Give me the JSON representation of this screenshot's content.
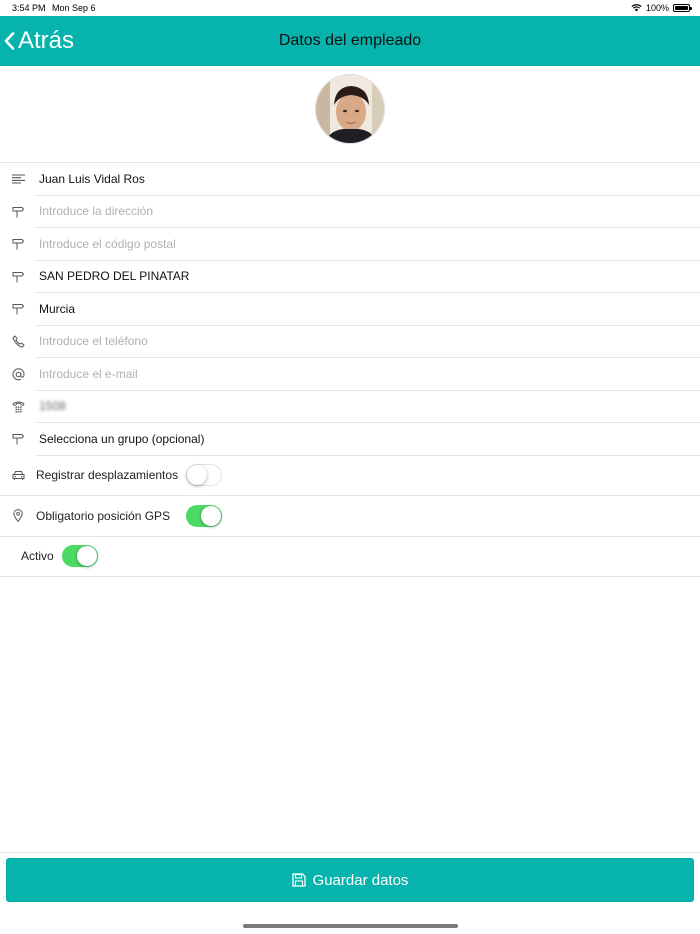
{
  "status_bar": {
    "time": "3:54 PM",
    "date": "Mon Sep 6",
    "battery": "100%"
  },
  "nav": {
    "back_label": "Atrás",
    "title": "Datos del empleado"
  },
  "form": {
    "name": "Juan Luis Vidal Ros",
    "address_placeholder": "Introduce la dirección",
    "postal_placeholder": "Introduce el código postal",
    "city": "SAN PEDRO DEL PINATAR",
    "province": "Murcia",
    "phone_placeholder": "Introduce el teléfono",
    "email_placeholder": "Introduce el e-mail",
    "code": "1508",
    "group": "Selecciona un grupo (opcional)"
  },
  "toggles": {
    "travel": {
      "label": "Registrar desplazamientos",
      "on": false
    },
    "gps": {
      "label": "Obligatorio posición GPS",
      "on": true
    },
    "active": {
      "label": "Activo",
      "on": true
    }
  },
  "actions": {
    "save_label": "Guardar datos"
  },
  "colors": {
    "primary": "#06b3ad",
    "switch_on": "#4cd964",
    "placeholder": "#b0b0b0"
  }
}
